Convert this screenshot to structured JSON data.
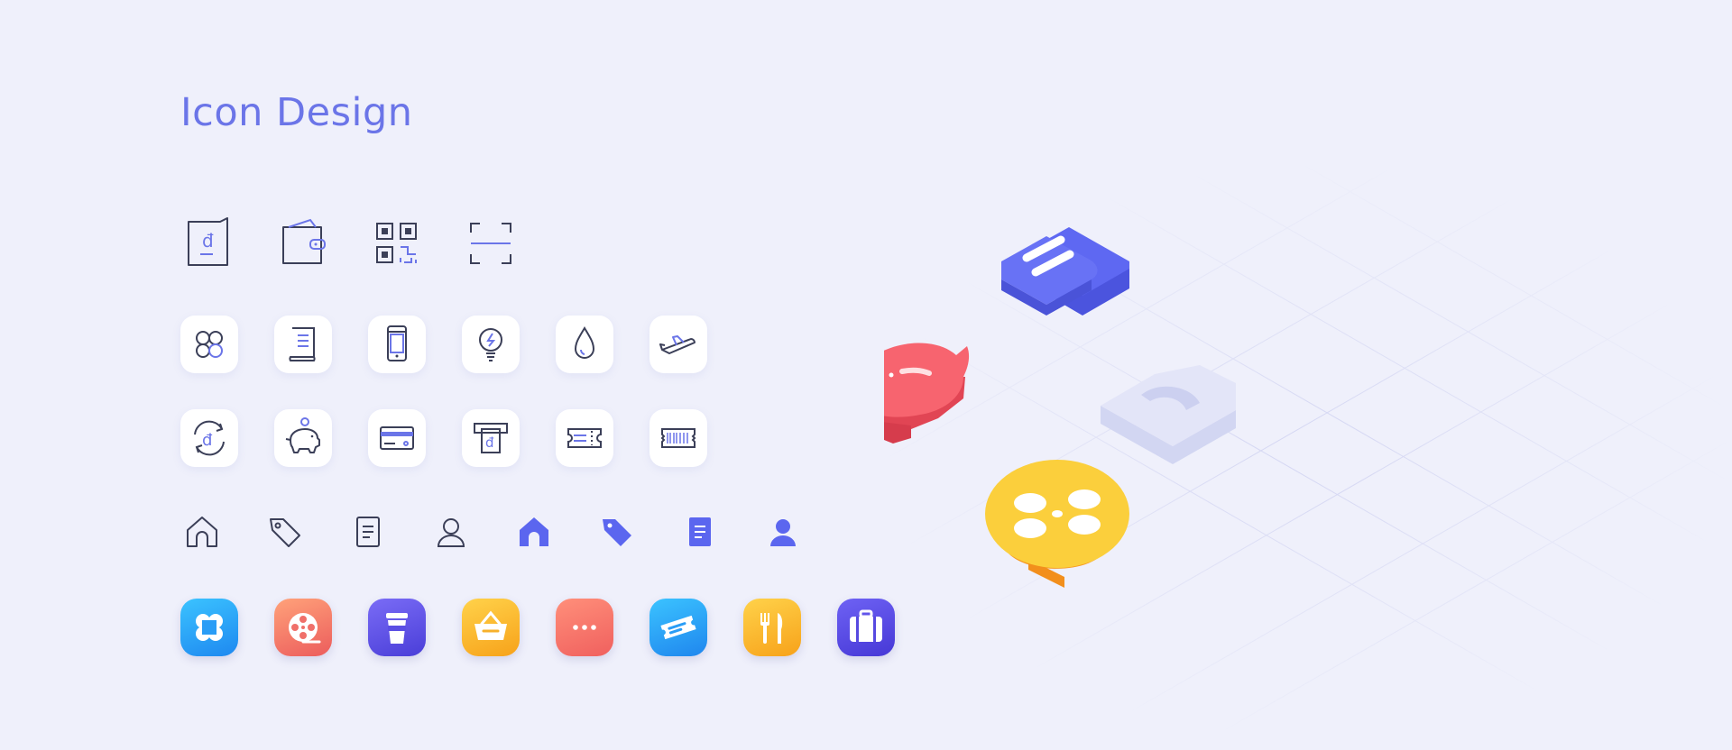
{
  "page": {
    "title": "Icon Design"
  },
  "row1_icons": [
    "dong-wallet-icon",
    "wallet-icon",
    "qr-code-icon",
    "scan-frame-icon"
  ],
  "row2_icons": [
    "apps-icon",
    "receipt-icon",
    "phone-icon",
    "electricity-icon",
    "water-drop-icon",
    "airplane-icon"
  ],
  "row3_icons": [
    "dong-exchange-icon",
    "piggy-bank-icon",
    "credit-card-icon",
    "atm-withdraw-icon",
    "ticket-icon",
    "barcode-ticket-icon"
  ],
  "row4_icons": [
    "home-outline-icon",
    "tag-outline-icon",
    "document-outline-icon",
    "user-outline-icon",
    "home-filled-icon",
    "tag-filled-icon",
    "document-filled-icon",
    "user-filled-icon"
  ],
  "row5_icons": [
    "apps-app-icon",
    "film-app-icon",
    "cup-app-icon",
    "basket-app-icon",
    "more-app-icon",
    "ticket-app-icon",
    "food-app-icon",
    "luggage-app-icon"
  ],
  "iso_icons": [
    "iso-ticket-icon",
    "iso-piggy-bank-icon",
    "iso-home-icon",
    "iso-film-reel-icon"
  ],
  "colors": {
    "accent": "#6b75e8",
    "stroke": "#3b3f58",
    "iso_blue": "#5b66ef",
    "iso_red": "#f4606b",
    "iso_yellow": "#fbcf3c",
    "iso_orange": "#f7a12a",
    "iso_ghost": "#dcdff6"
  }
}
